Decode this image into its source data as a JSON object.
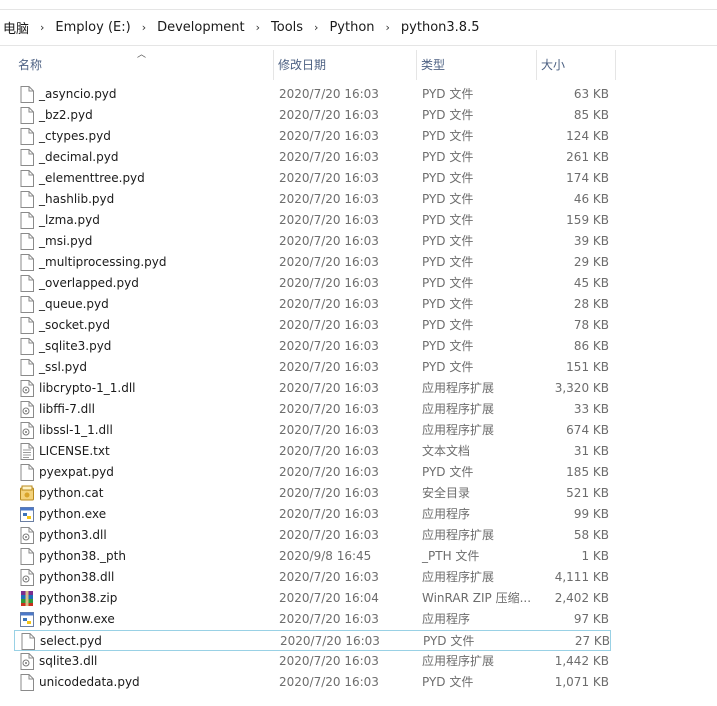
{
  "breadcrumb": [
    "电脑",
    "Employ (E:)",
    "Development",
    "Tools",
    "Python",
    "python3.8.5"
  ],
  "columns": {
    "name": "名称",
    "date": "修改日期",
    "type": "类型",
    "size": "大小"
  },
  "icons": {
    "file": "file-icon",
    "dll": "dll-icon",
    "text": "text-file-icon",
    "cat": "catalog-icon",
    "exe": "python-exe-icon",
    "zip": "winrar-zip-icon"
  },
  "files": [
    {
      "name": "_asyncio.pyd",
      "date": "2020/7/20 16:03",
      "type": "PYD 文件",
      "size": "63 KB",
      "icon": "file"
    },
    {
      "name": "_bz2.pyd",
      "date": "2020/7/20 16:03",
      "type": "PYD 文件",
      "size": "85 KB",
      "icon": "file"
    },
    {
      "name": "_ctypes.pyd",
      "date": "2020/7/20 16:03",
      "type": "PYD 文件",
      "size": "124 KB",
      "icon": "file"
    },
    {
      "name": "_decimal.pyd",
      "date": "2020/7/20 16:03",
      "type": "PYD 文件",
      "size": "261 KB",
      "icon": "file"
    },
    {
      "name": "_elementtree.pyd",
      "date": "2020/7/20 16:03",
      "type": "PYD 文件",
      "size": "174 KB",
      "icon": "file"
    },
    {
      "name": "_hashlib.pyd",
      "date": "2020/7/20 16:03",
      "type": "PYD 文件",
      "size": "46 KB",
      "icon": "file"
    },
    {
      "name": "_lzma.pyd",
      "date": "2020/7/20 16:03",
      "type": "PYD 文件",
      "size": "159 KB",
      "icon": "file"
    },
    {
      "name": "_msi.pyd",
      "date": "2020/7/20 16:03",
      "type": "PYD 文件",
      "size": "39 KB",
      "icon": "file"
    },
    {
      "name": "_multiprocessing.pyd",
      "date": "2020/7/20 16:03",
      "type": "PYD 文件",
      "size": "29 KB",
      "icon": "file"
    },
    {
      "name": "_overlapped.pyd",
      "date": "2020/7/20 16:03",
      "type": "PYD 文件",
      "size": "45 KB",
      "icon": "file"
    },
    {
      "name": "_queue.pyd",
      "date": "2020/7/20 16:03",
      "type": "PYD 文件",
      "size": "28 KB",
      "icon": "file"
    },
    {
      "name": "_socket.pyd",
      "date": "2020/7/20 16:03",
      "type": "PYD 文件",
      "size": "78 KB",
      "icon": "file"
    },
    {
      "name": "_sqlite3.pyd",
      "date": "2020/7/20 16:03",
      "type": "PYD 文件",
      "size": "86 KB",
      "icon": "file"
    },
    {
      "name": "_ssl.pyd",
      "date": "2020/7/20 16:03",
      "type": "PYD 文件",
      "size": "151 KB",
      "icon": "file"
    },
    {
      "name": "libcrypto-1_1.dll",
      "date": "2020/7/20 16:03",
      "type": "应用程序扩展",
      "size": "3,320 KB",
      "icon": "dll"
    },
    {
      "name": "libffi-7.dll",
      "date": "2020/7/20 16:03",
      "type": "应用程序扩展",
      "size": "33 KB",
      "icon": "dll"
    },
    {
      "name": "libssl-1_1.dll",
      "date": "2020/7/20 16:03",
      "type": "应用程序扩展",
      "size": "674 KB",
      "icon": "dll"
    },
    {
      "name": "LICENSE.txt",
      "date": "2020/7/20 16:03",
      "type": "文本文档",
      "size": "31 KB",
      "icon": "text"
    },
    {
      "name": "pyexpat.pyd",
      "date": "2020/7/20 16:03",
      "type": "PYD 文件",
      "size": "185 KB",
      "icon": "file"
    },
    {
      "name": "python.cat",
      "date": "2020/7/20 16:03",
      "type": "安全目录",
      "size": "521 KB",
      "icon": "cat"
    },
    {
      "name": "python.exe",
      "date": "2020/7/20 16:03",
      "type": "应用程序",
      "size": "99 KB",
      "icon": "exe"
    },
    {
      "name": "python3.dll",
      "date": "2020/7/20 16:03",
      "type": "应用程序扩展",
      "size": "58 KB",
      "icon": "dll"
    },
    {
      "name": "python38._pth",
      "date": "2020/9/8 16:45",
      "type": "_PTH 文件",
      "size": "1 KB",
      "icon": "file"
    },
    {
      "name": "python38.dll",
      "date": "2020/7/20 16:03",
      "type": "应用程序扩展",
      "size": "4,111 KB",
      "icon": "dll"
    },
    {
      "name": "python38.zip",
      "date": "2020/7/20 16:04",
      "type": "WinRAR ZIP 压缩...",
      "size": "2,402 KB",
      "icon": "zip"
    },
    {
      "name": "pythonw.exe",
      "date": "2020/7/20 16:03",
      "type": "应用程序",
      "size": "97 KB",
      "icon": "exe"
    },
    {
      "name": "select.pyd",
      "date": "2020/7/20 16:03",
      "type": "PYD 文件",
      "size": "27 KB",
      "icon": "file",
      "focused": true
    },
    {
      "name": "sqlite3.dll",
      "date": "2020/7/20 16:03",
      "type": "应用程序扩展",
      "size": "1,442 KB",
      "icon": "dll"
    },
    {
      "name": "unicodedata.pyd",
      "date": "2020/7/20 16:03",
      "type": "PYD 文件",
      "size": "1,071 KB",
      "icon": "file"
    }
  ]
}
